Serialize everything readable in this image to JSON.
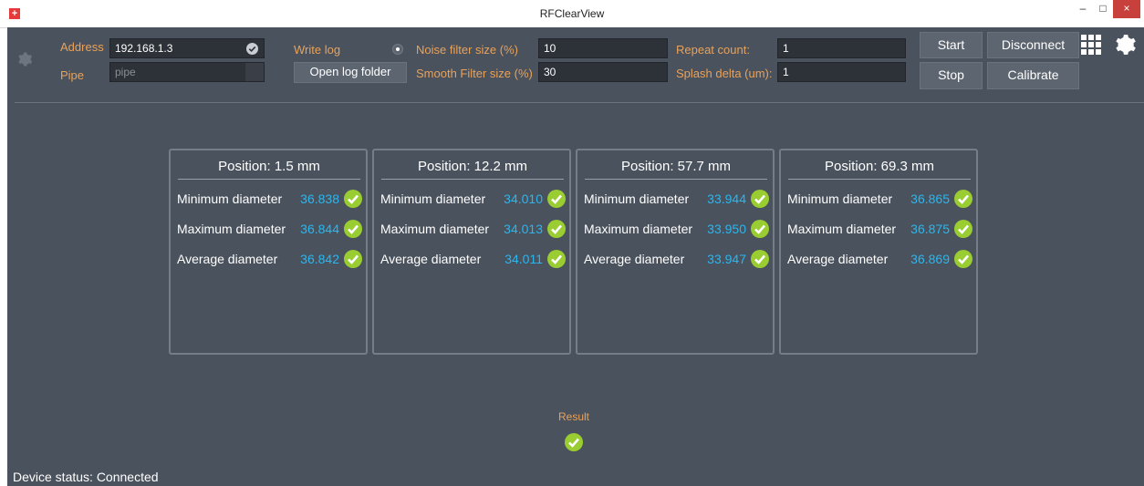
{
  "window": {
    "title": "RFClearView",
    "minimize_glyph": "–",
    "maximize_glyph": "□",
    "close_glyph": "×"
  },
  "connection": {
    "address_label": "Address",
    "address_value": "192.168.1.3",
    "pipe_label": "Pipe",
    "pipe_placeholder": "pipe"
  },
  "logging": {
    "write_log_label": "Write log",
    "write_log_selected": true,
    "open_log_folder_label": "Open log folder"
  },
  "filters": {
    "noise_label": "Noise filter size (%)",
    "noise_value": "10",
    "smooth_label": "Smooth Filter size (%)",
    "smooth_value": "30",
    "repeat_label": "Repeat count:",
    "repeat_value": "1",
    "splash_label": "Splash delta (um):",
    "splash_value": "1"
  },
  "actions": {
    "start_label": "Start",
    "stop_label": "Stop",
    "disconnect_label": "Disconnect",
    "calibrate_label": "Calibrate"
  },
  "cards": [
    {
      "title": "Position: 1.5 mm",
      "rows": [
        {
          "label": "Minimum diameter",
          "value": "36.838"
        },
        {
          "label": "Maximum diameter",
          "value": "36.844"
        },
        {
          "label": "Average diameter",
          "value": "36.842"
        }
      ]
    },
    {
      "title": "Position: 12.2 mm",
      "rows": [
        {
          "label": "Minimum diameter",
          "value": "34.010"
        },
        {
          "label": "Maximum diameter",
          "value": "34.013"
        },
        {
          "label": "Average diameter",
          "value": "34.011"
        }
      ]
    },
    {
      "title": "Position: 57.7 mm",
      "rows": [
        {
          "label": "Minimum diameter",
          "value": "33.944"
        },
        {
          "label": "Maximum diameter",
          "value": "33.950"
        },
        {
          "label": "Average diameter",
          "value": "33.947"
        }
      ]
    },
    {
      "title": "Position: 69.3 mm",
      "rows": [
        {
          "label": "Minimum diameter",
          "value": "36.865"
        },
        {
          "label": "Maximum diameter",
          "value": "36.875"
        },
        {
          "label": "Average diameter",
          "value": "36.869"
        }
      ]
    }
  ],
  "result": {
    "label": "Result"
  },
  "status": {
    "text": "Device status: Connected"
  },
  "colors": {
    "background": "#4a525d",
    "accent_label": "#e8a25a",
    "value_blue": "#2bb6ee",
    "check_green": "#9acd32"
  }
}
